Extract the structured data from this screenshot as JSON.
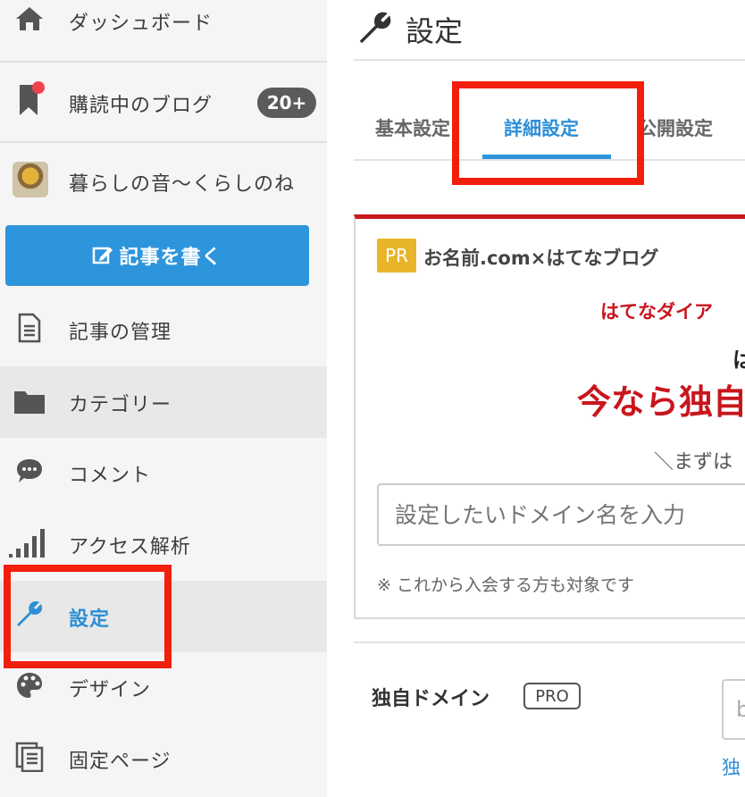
{
  "sidebar": {
    "items": [
      {
        "label": "ダッシュボード",
        "icon": "home-icon"
      },
      {
        "label": "購読中のブログ",
        "icon": "bookmark-icon",
        "badge": "20+"
      },
      {
        "label": "暮らしの音〜くらしのね",
        "icon": "blog-avatar"
      },
      {
        "label": "記事の管理",
        "icon": "document-icon"
      },
      {
        "label": "カテゴリー",
        "icon": "folder-icon"
      },
      {
        "label": "コメント",
        "icon": "comment-icon"
      },
      {
        "label": "アクセス解析",
        "icon": "bar-signal-icon"
      },
      {
        "label": "設定",
        "icon": "wrench-icon",
        "active": true
      },
      {
        "label": "デザイン",
        "icon": "palette-icon"
      },
      {
        "label": "固定ページ",
        "icon": "pages-icon"
      }
    ],
    "write_button": "記事を書く"
  },
  "main": {
    "title": "設定",
    "tabs": [
      {
        "label": "基本設定"
      },
      {
        "label": "詳細設定",
        "active": true
      },
      {
        "label": "公開設定"
      }
    ],
    "pr": {
      "badge": "PR",
      "title": "お名前.com×はてなブログ",
      "line1": "はてなダイア",
      "line2": "は",
      "line3": "今なら独自",
      "line4": "＼まずは",
      "input_placeholder": "設定したいドメイン名を入力",
      "note": "※ これから入会する方も対象です"
    },
    "domain_section": {
      "label": "独自ドメイン",
      "badge": "PRO",
      "input_value": "b",
      "link": "独"
    }
  },
  "colors": {
    "accent": "#2d95dc",
    "highlight_box": "#f21f0c",
    "pr_red": "#c8161d",
    "pr_badge": "#e8b52a"
  }
}
